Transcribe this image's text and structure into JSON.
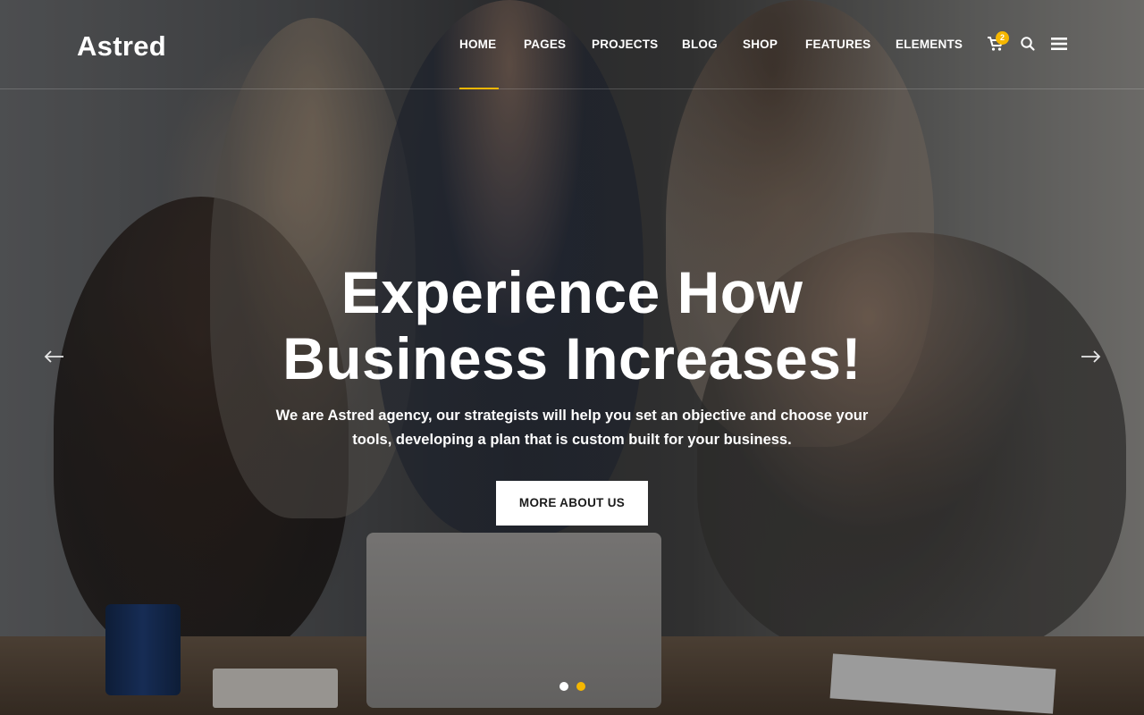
{
  "brand": {
    "name": "Astred",
    "accent_color": "#f5b700"
  },
  "nav": {
    "items": [
      {
        "label": "HOME",
        "active": true
      },
      {
        "label": "PAGES",
        "active": false
      },
      {
        "label": "PROJECTS",
        "active": false
      },
      {
        "label": "BLOG",
        "active": false
      },
      {
        "label": "SHOP",
        "active": false
      },
      {
        "label": "FEATURES",
        "active": false
      },
      {
        "label": "ELEMENTS",
        "active": false
      }
    ],
    "cart_count": "2",
    "icons": [
      "cart-icon",
      "search-icon",
      "hamburger-menu-icon"
    ]
  },
  "hero": {
    "headline_line1": "Experience How",
    "headline_line2": "Business Increases!",
    "subtext_line1": "We are Astred agency, our strategists will help you set an objective and choose your",
    "subtext_line2": "tools, developing a plan that is custom built for your business.",
    "cta_label": "MORE ABOUT US",
    "prev_icon": "arrow-left-icon",
    "next_icon": "arrow-right-icon"
  },
  "slider": {
    "slide_count": 2,
    "active_slide": 2
  }
}
